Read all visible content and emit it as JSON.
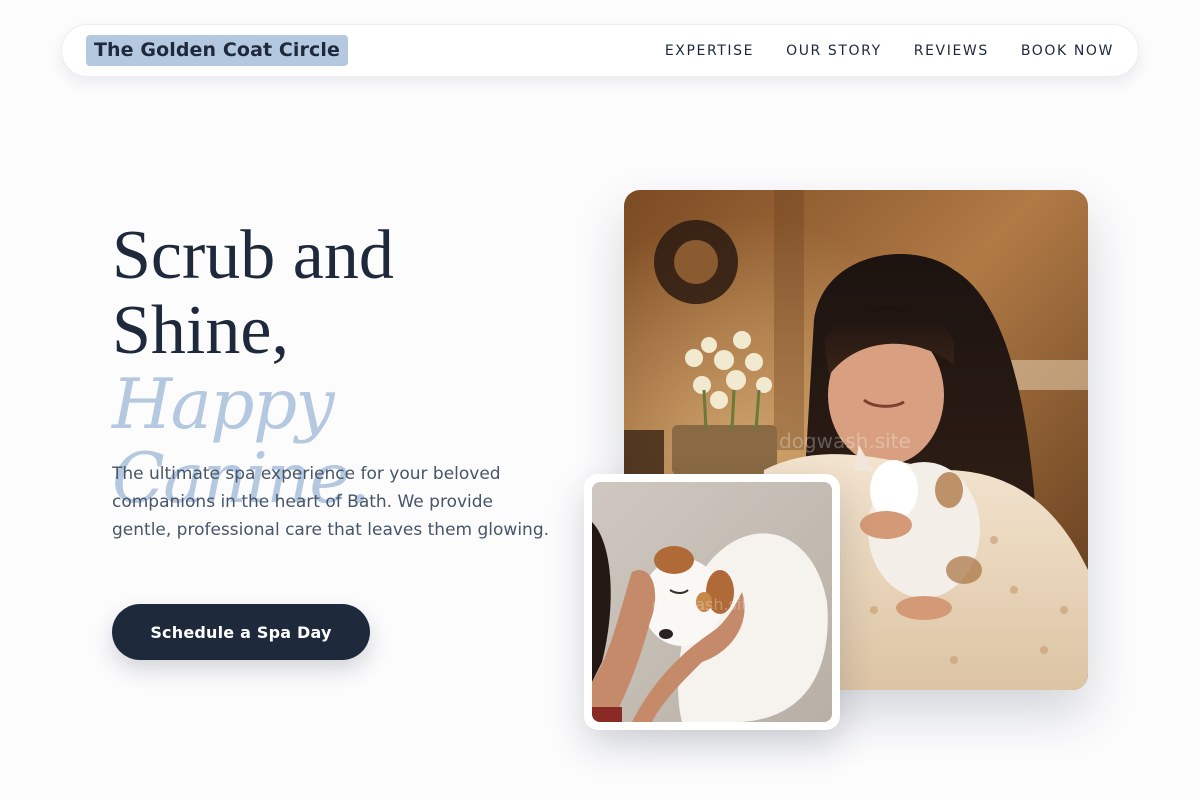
{
  "nav": {
    "brand": "The Golden Coat Circle",
    "links": [
      "EXPERTISE",
      "OUR STORY",
      "REVIEWS",
      "BOOK NOW"
    ]
  },
  "hero": {
    "title_line1": "Scrub and",
    "title_line2": "Shine,",
    "title_accent": "Happy Canine.",
    "description": "The ultimate spa experience for your beloved companions in the heart of Bath. We provide gentle, professional care that leaves them glowing.",
    "cta_label": "Schedule a Spa Day"
  },
  "images": {
    "main_alt": "Woman smiling while holding a fluffy white dog",
    "small_alt": "Hands cradling the head of a white and brown puppy",
    "watermark": "dogwash.site"
  },
  "colors": {
    "navy": "#1e293b",
    "accent_blue": "#b4c8e0",
    "body_text": "#475569",
    "background": "#fcfcfd"
  }
}
